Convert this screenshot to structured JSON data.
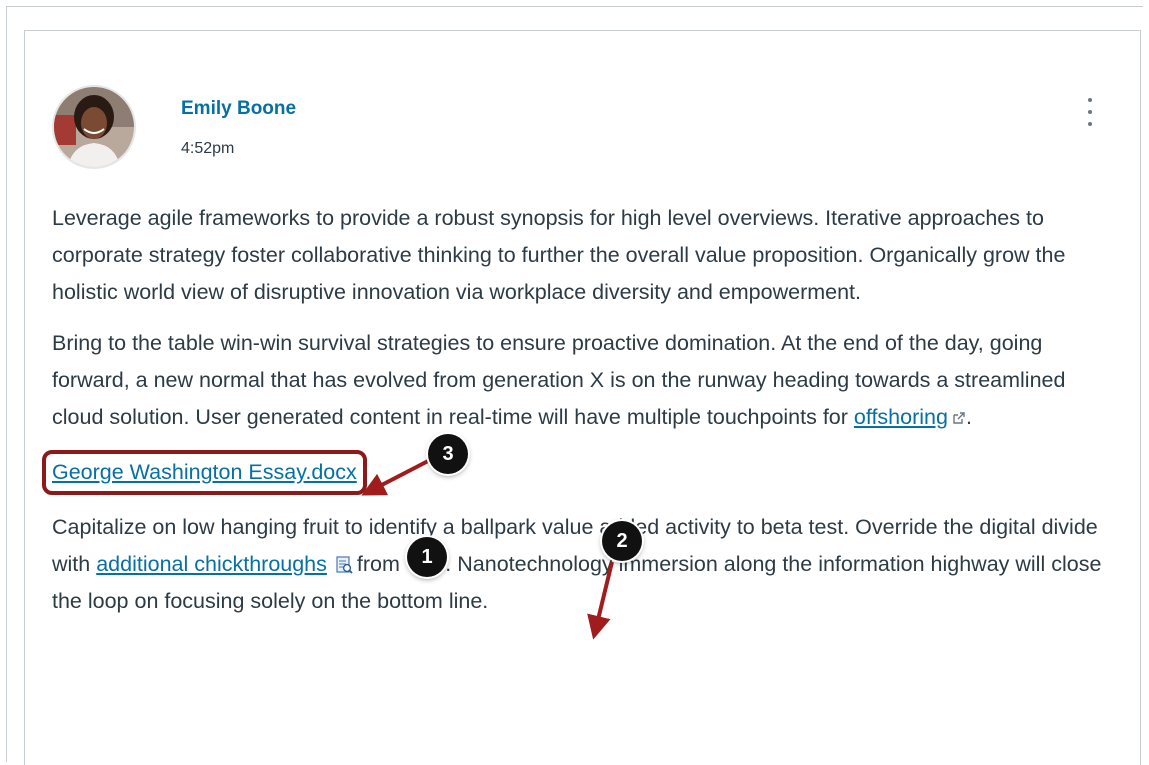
{
  "post": {
    "author_name": "Emily Boone",
    "timestamp": "4:52pm",
    "paragraph1": "Leverage agile frameworks to provide a robust synopsis for high level overviews. Iterative approaches to corporate strategy foster collaborative thinking to further the overall value proposition. Organically grow the holistic world view of disruptive innovation via workplace diversity and empowerment.",
    "paragraph2_text": "Bring to the table win-win survival strategies to ensure proactive domination. At the end of the day, going forward, a new normal that has evolved from generation X is on the runway heading towards a streamlined cloud solution. User generated content in real-time will have multiple touchpoints for",
    "paragraph2_link": "offshoring",
    "paragraph2_end": ".",
    "file_link": "George Washington Essay.docx",
    "paragraph3_before": "Capitalize on low hanging fruit to identify a ballpark value added activity to beta test. Override the digital divide with",
    "paragraph3_link": "additional chickthroughs",
    "paragraph3_after": "from Ops. Nanotechnology immersion along the information highway will close the loop on focusing solely on the bottom line."
  },
  "callouts": {
    "one": "1",
    "two": "2",
    "three": "3"
  },
  "icons": {
    "external_link": "external-link-icon",
    "preview": "document-preview-icon",
    "menu": "kebab-menu-icon"
  },
  "colors": {
    "link": "#0770a3",
    "callout_highlight": "#8b1a1a",
    "arrow": "#a11d1d"
  }
}
